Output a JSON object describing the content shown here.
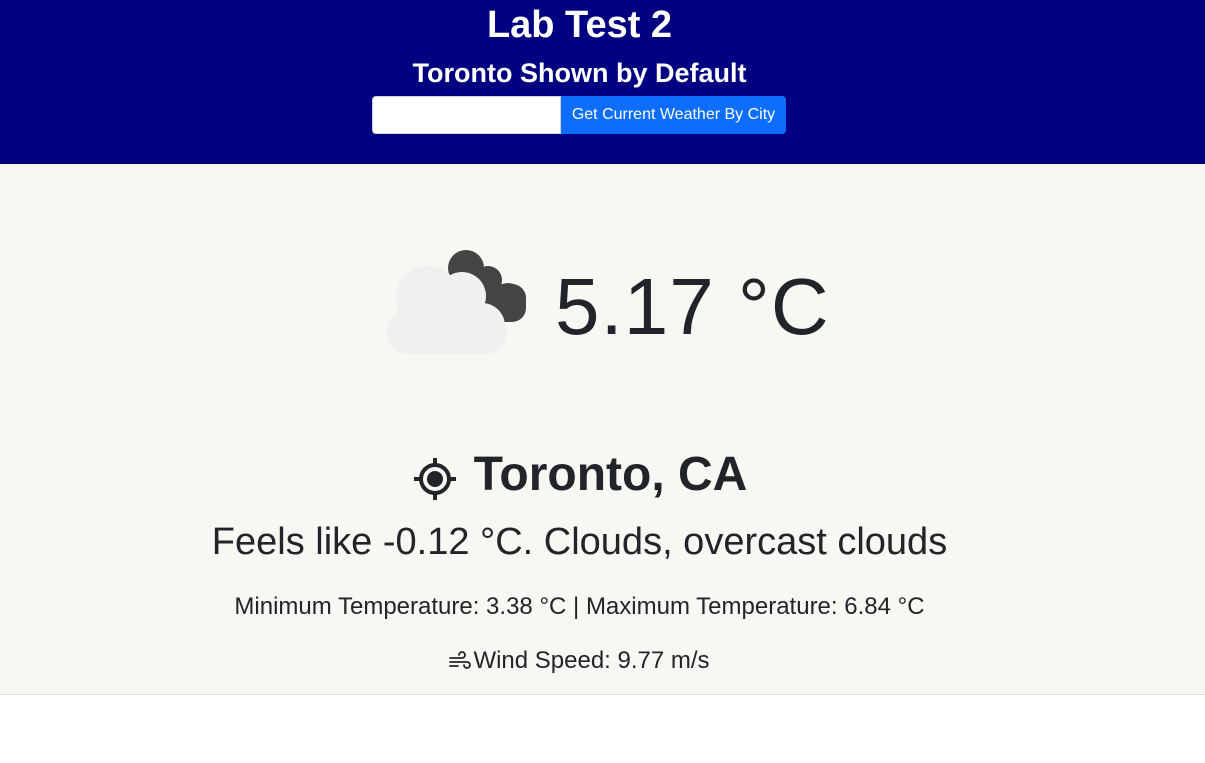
{
  "header": {
    "title": "Lab Test 2",
    "subtitle": "Toronto Shown by Default",
    "search": {
      "value": "",
      "placeholder": "",
      "button_label": "Get Current Weather By City"
    },
    "background_color": "#000080",
    "button_color": "#0d6efd"
  },
  "weather": {
    "icon": "overcast-clouds-icon",
    "temperature": "5.17 °C",
    "location_icon": "location-crosshair-icon",
    "location": "Toronto, CA",
    "feels_like": "Feels like -0.12 °C. Clouds, overcast clouds",
    "min_max": "Minimum Temperature: 3.38 °C | Maximum Temperature: 6.84 °C",
    "wind_icon": "wind-icon",
    "wind": "Wind Speed: 9.77 m/s"
  }
}
